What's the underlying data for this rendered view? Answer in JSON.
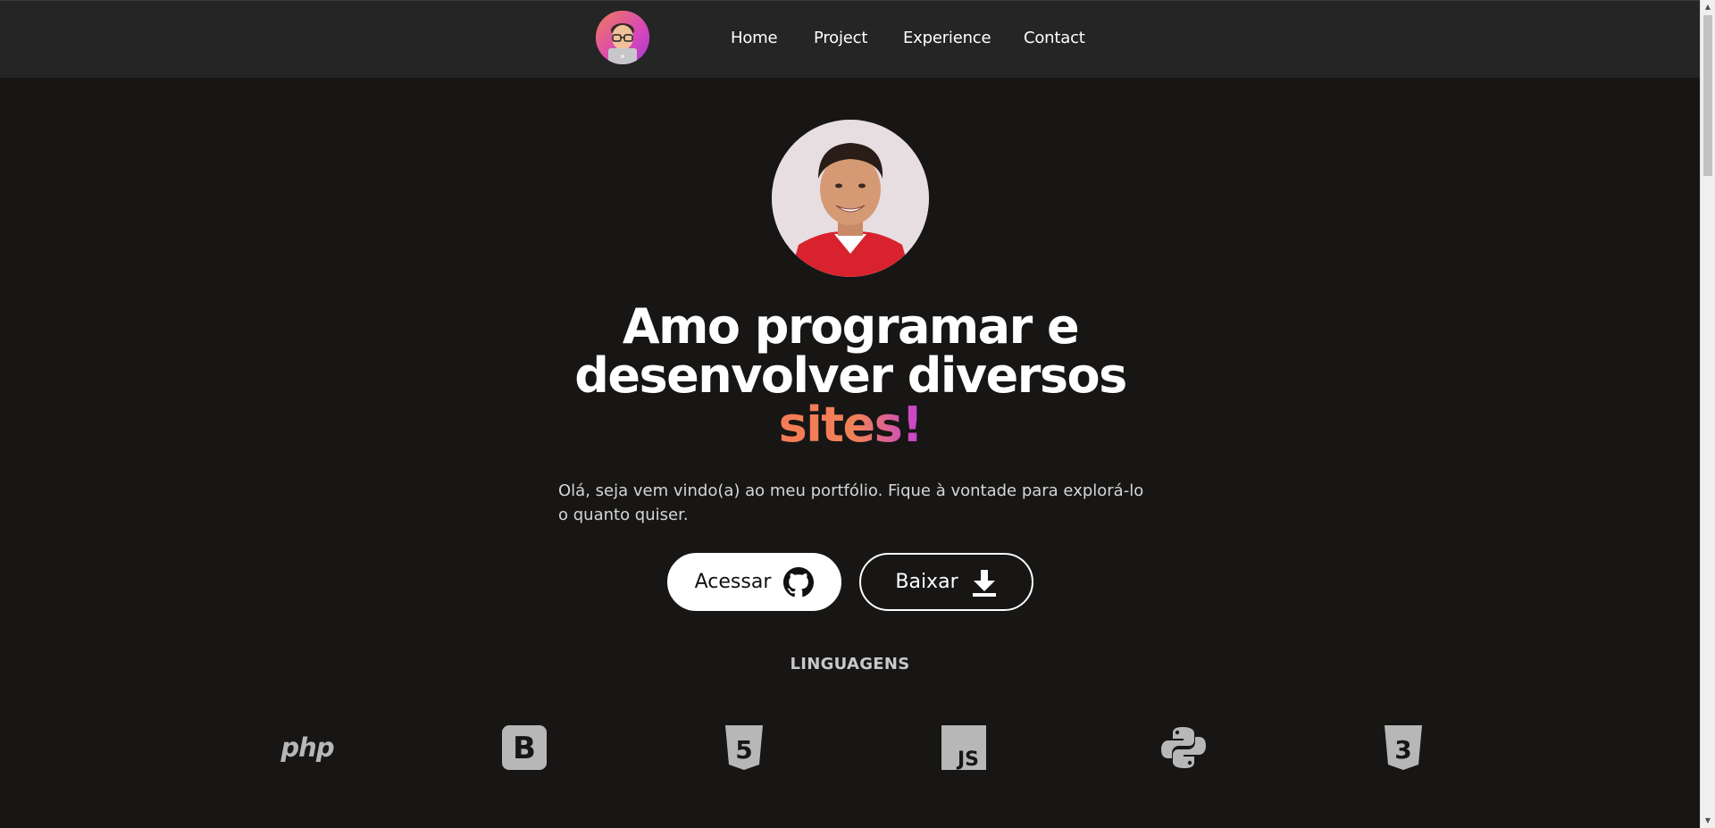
{
  "nav": {
    "items": [
      {
        "label": "Home"
      },
      {
        "label": "Project"
      },
      {
        "label": "Experience"
      },
      {
        "label": "Contact"
      }
    ]
  },
  "hero": {
    "headline_line1": "Amo programar e",
    "headline_line2": "desenvolver diversos",
    "headline_highlight": "sites!",
    "intro": "Olá, seja vem vindo(a) ao meu portfólio. Fique à vontade para explorá-lo o quanto quiser."
  },
  "buttons": {
    "access_label": "Acessar",
    "download_label": "Baixar"
  },
  "languages": {
    "title": "LINGUAGENS",
    "items": [
      {
        "icon": "php-icon",
        "text": "php"
      },
      {
        "icon": "bootstrap-icon"
      },
      {
        "icon": "html5-icon"
      },
      {
        "icon": "javascript-icon"
      },
      {
        "icon": "python-icon"
      },
      {
        "icon": "css3-icon"
      }
    ]
  },
  "colors": {
    "background": "#171615",
    "header": "#252525",
    "accent_orange": "#f47c55",
    "accent_purple": "#c53fd6",
    "icon_gray": "#b7b7b7"
  }
}
